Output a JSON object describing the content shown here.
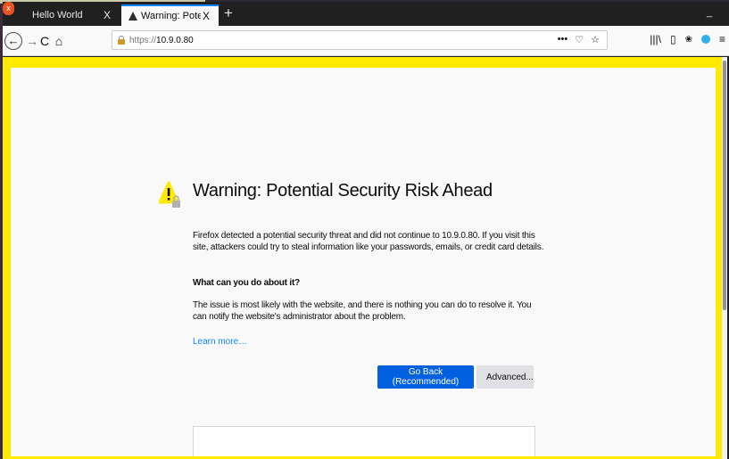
{
  "tabs": [
    {
      "title": "Hello World",
      "close": "X"
    },
    {
      "title": "Warning: Potential Security Risk Ahead",
      "close": "X"
    }
  ],
  "new_tab": "+",
  "window_controls": {
    "minimize": "_",
    "maximize": "▢",
    "close": "x"
  },
  "nav": {
    "back": "←",
    "forward": "→",
    "reload": "C",
    "home": "⌂",
    "url_scheme": "https://",
    "url_host": "10.9.0.80",
    "page_actions": "•••",
    "pocket": "♡",
    "bookmark": "☆",
    "library": "|||\\",
    "sidebar": "▯",
    "menu": "≡"
  },
  "page": {
    "title": "Warning: Potential Security Risk Ahead",
    "description": "Firefox detected a potential security threat and did not continue to 10.9.0.80. If you visit this site, attackers could try to steal information like your passwords, emails, or credit card details.",
    "what_heading": "What can you do about it?",
    "what_body": "The issue is most likely with the website, and there is nothing you can do to resolve it. You can notify the website's administrator about the problem.",
    "learn_more": "Learn more…",
    "go_back_button": "Go Back (Recommended)",
    "advanced_button": "Advanced..."
  },
  "colors": {
    "border_highlight": "#ffe900",
    "primary_button": "#0060df",
    "link": "#0a84ff",
    "warning_icon": "#ffe900"
  }
}
